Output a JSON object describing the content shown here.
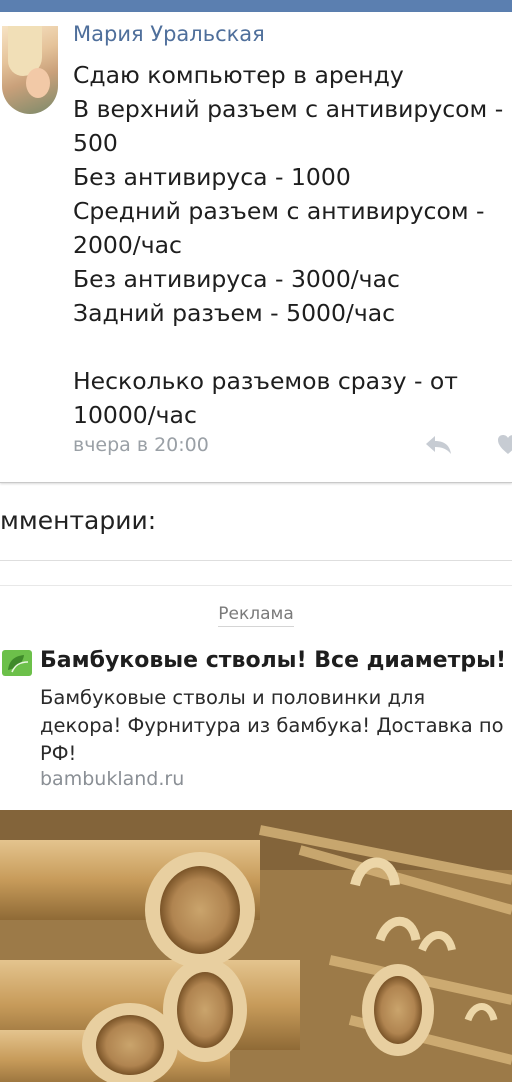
{
  "post": {
    "author": "Мария Уральская",
    "lines": [
      "Сдаю компьютер в аренду",
      "В верхний разъем с антивирусом -",
      "500",
      "Без антивируса - 1000",
      "Средний разъем с антивирусом -",
      "2000/час",
      "Без антивируса - 3000/час",
      "Задний разъем - 5000/час"
    ],
    "lines_after_gap": [
      "Несколько разъемов сразу - от",
      "10000/час"
    ],
    "time": "вчера в 20:00",
    "icons": {
      "reply": "reply-arrow-icon",
      "like": "heart-icon"
    }
  },
  "comments": {
    "heading": "мментарии:"
  },
  "ad": {
    "label": "Реклама",
    "icon": "bamboo-leaf-icon",
    "title": "Бамбуковые стволы! Все диаметры!",
    "body_lines": [
      "Бамбуковые стволы и половинки для",
      "декора! Фурнитура из бамбука! Доставка по",
      "РФ!"
    ],
    "domain": "bambukland.ru",
    "colors": {
      "leaf": "#5cb85c",
      "author": "#4f6f9b",
      "topbar": "#5b7fb0"
    }
  }
}
